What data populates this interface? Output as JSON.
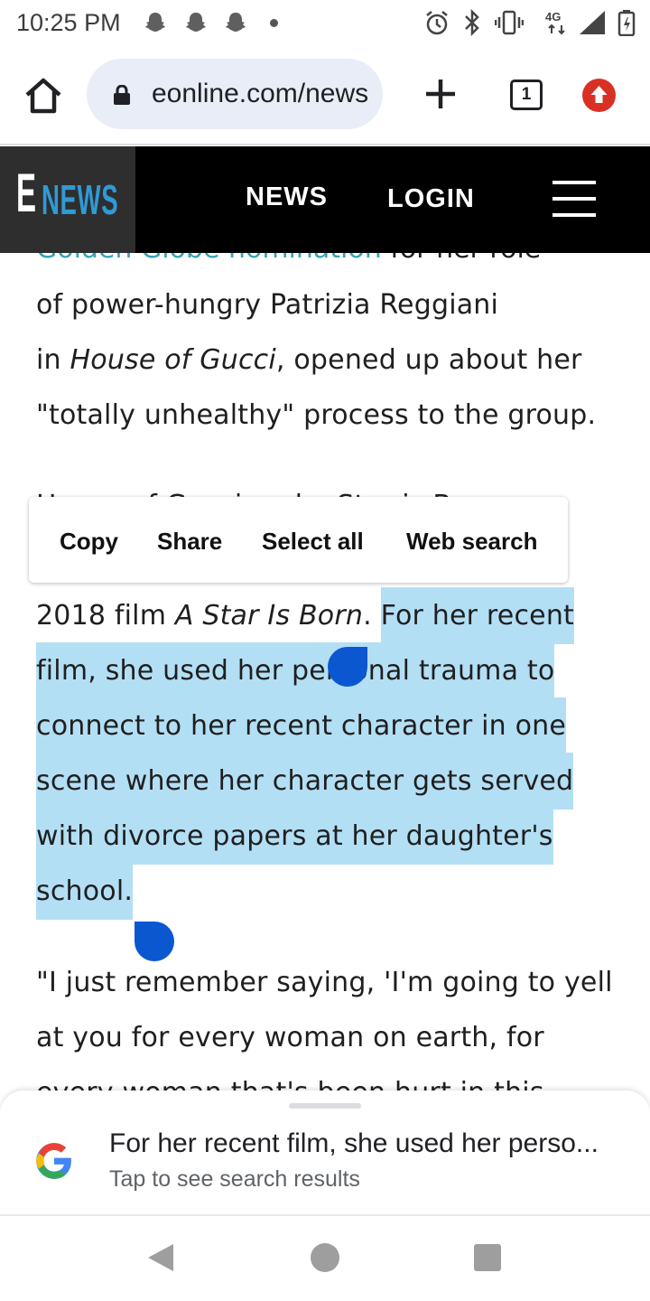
{
  "status_bar": {
    "time": "10:25 PM",
    "icons": [
      "snapchat-icon",
      "snapchat-icon",
      "snapchat-icon",
      "notification-dot",
      "alarm-icon",
      "bluetooth-icon",
      "vibrate-icon",
      "4g-icon",
      "signal-icon",
      "battery-icon"
    ],
    "network_label": "4G"
  },
  "browser": {
    "url": "eonline.com/news",
    "tab_count": "1"
  },
  "site_header": {
    "logo_e": "E",
    "logo_news": "NEWS",
    "nav_news": "NEWS",
    "nav_login": "LOGIN"
  },
  "article": {
    "line0_link": "Golden Globe nomination",
    "line0_rest": " for her role",
    "line1": "of power-hungry Patrizia Reggiani",
    "line2_a": "in ",
    "line2_em": "House of Gucci",
    "line2_b": ", opened up about her",
    "line3": "\"totally unhealthy\" process to the group.",
    "line4_partial": "House of Gucci and a Star is Born",
    "line5_a": "2018 film ",
    "line5_em": "A Star Is Born",
    "line5_b": ". ",
    "line5_sel": "For her recent",
    "line6_sel": "film, she used her personal trauma to",
    "line7_sel": "connect to her recent character in one",
    "line8_sel": "scene where her character gets served",
    "line9_sel": "with divorce papers at her daughter's",
    "line10_sel": "school.",
    "line11": "\"I just remember saying, 'I'm going to yell",
    "line12": "at you for every woman on earth, for",
    "line13_partial": "every woman that's been hurt in this"
  },
  "context_menu": {
    "copy": "Copy",
    "share": "Share",
    "select_all": "Select all",
    "web_search": "Web search"
  },
  "search_sheet": {
    "title": "For her recent film, she used her perso...",
    "subtitle": "Tap to see search results"
  },
  "colors": {
    "selection": "#b3dff5",
    "handle": "#0b57d0",
    "link": "#35a3b8",
    "logo_blue": "#2f9ad6"
  }
}
